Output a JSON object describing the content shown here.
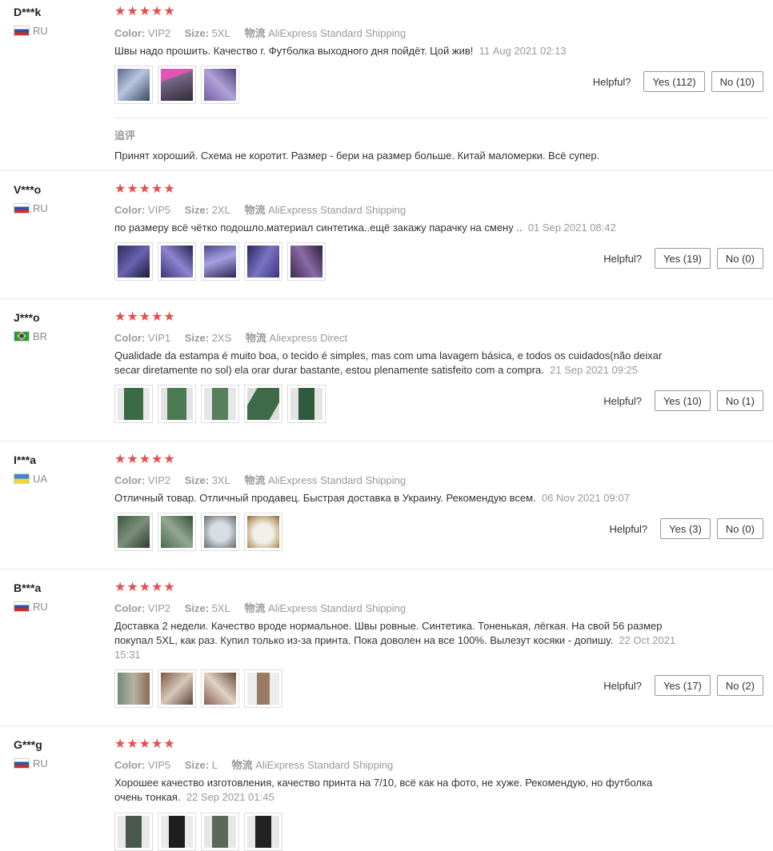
{
  "reviews": [
    {
      "user": "D***k",
      "country": "RU",
      "stars": "★★★★★",
      "color_label": "Color:",
      "color": "VIP2",
      "size_label": "Size:",
      "size": "5XL",
      "ship_label": "物流",
      "shipping": "AliExpress Standard Shipping",
      "text": "Швы надо прошить. Качество г. Футболка выходного дня пойдёт. Цой жив!",
      "date": "11 Aug 2021 02:13",
      "helpful_label": "Helpful?",
      "yes": "Yes (112)",
      "no": "No (10)",
      "followup_title": "追评",
      "followup_text": "Принят хороший. Схема не коротит. Размер - бери на размер больше. Китай маломерки. Всё супер."
    },
    {
      "user": "V***o",
      "country": "RU",
      "stars": "★★★★★",
      "color_label": "Color:",
      "color": "VIP5",
      "size_label": "Size:",
      "size": "2XL",
      "ship_label": "物流",
      "shipping": "AliExpress Standard Shipping",
      "text": "по размеру всё чётко подошло.материал синтетика..ещё закажу парачку на смену ..",
      "date": "01 Sep 2021 08:42",
      "helpful_label": "Helpful?",
      "yes": "Yes (19)",
      "no": "No (0)"
    },
    {
      "user": "J***o",
      "country": "BR",
      "stars": "★★★★★",
      "color_label": "Color:",
      "color": "VIP1",
      "size_label": "Size:",
      "size": "2XS",
      "ship_label": "物流",
      "shipping": "Aliexpress Direct",
      "text": "Qualidade da estampa é muito boa, o tecido é simples, mas com uma lavagem básica, e todos os cuidados(não deixar secar diretamente no sol) ela orar durar bastante, estou plenamente satisfeito com a compra.",
      "date": "21 Sep 2021 09:25",
      "helpful_label": "Helpful?",
      "yes": "Yes (10)",
      "no": "No (1)"
    },
    {
      "user": "I***a",
      "country": "UA",
      "stars": "★★★★★",
      "color_label": "Color:",
      "color": "VIP2",
      "size_label": "Size:",
      "size": "3XL",
      "ship_label": "物流",
      "shipping": "AliExpress Standard Shipping",
      "text": "Отличный товар. Отличный продавец. Быстрая доставка в Украину. Рекомендую всем.",
      "date": "06 Nov 2021 09:07",
      "helpful_label": "Helpful?",
      "yes": "Yes (3)",
      "no": "No (0)"
    },
    {
      "user": "B***a",
      "country": "RU",
      "stars": "★★★★★",
      "color_label": "Color:",
      "color": "VIP2",
      "size_label": "Size:",
      "size": "5XL",
      "ship_label": "物流",
      "shipping": "AliExpress Standard Shipping",
      "text": "Доставка 2 недели. Качество вроде нормальное. Швы ровные. Синтетика. Тоненькая, лёгкая. На свой 56 размер покупал 5XL, как раз. Купил только из-за принта. Пока доволен на все 100%. Вылезут косяки - допишу.",
      "date": "22 Oct 2021 15:31",
      "helpful_label": "Helpful?",
      "yes": "Yes (17)",
      "no": "No (2)"
    },
    {
      "user": "G***g",
      "country": "RU",
      "stars": "★★★★★",
      "color_label": "Color:",
      "color": "VIP5",
      "size_label": "Size:",
      "size": "L",
      "ship_label": "物流",
      "shipping": "AliExpress Standard Shipping",
      "text": "Хорошее качество изготовления, качество принта на 7/10, всё как на фото, не хуже. Рекомендую, но футболка очень тонкая.",
      "date": "22 Sep 2021 01:45"
    }
  ],
  "colors": {
    "star": "#e94d4d",
    "muted": "#999999",
    "text": "#333333",
    "border": "#e8e8e8"
  }
}
